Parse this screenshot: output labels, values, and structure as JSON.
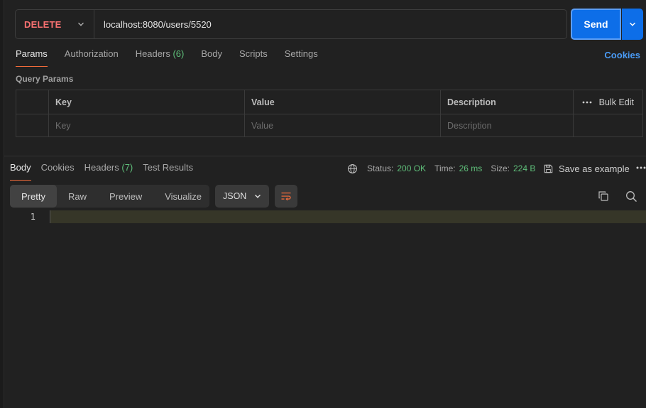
{
  "request": {
    "method": "DELETE",
    "url": "localhost:8080/users/5520",
    "send_label": "Send"
  },
  "request_tabs": [
    {
      "label": "Params",
      "active": true
    },
    {
      "label": "Authorization"
    },
    {
      "label": "Headers",
      "count": "(6)"
    },
    {
      "label": "Body"
    },
    {
      "label": "Scripts"
    },
    {
      "label": "Settings"
    }
  ],
  "cookies_label": "Cookies",
  "query_params": {
    "title": "Query Params",
    "columns": [
      "Key",
      "Value",
      "Description"
    ],
    "bulk_edit": "Bulk Edit",
    "placeholders": {
      "key": "Key",
      "value": "Value",
      "description": "Description"
    }
  },
  "response_tabs": [
    {
      "label": "Body",
      "active": true
    },
    {
      "label": "Cookies"
    },
    {
      "label": "Headers",
      "count": "(7)"
    },
    {
      "label": "Test Results"
    }
  ],
  "response_meta": {
    "status_label": "Status:",
    "status_value": "200 OK",
    "time_label": "Time:",
    "time_value": "26 ms",
    "size_label": "Size:",
    "size_value": "224 B",
    "save_example": "Save as example"
  },
  "view_modes": [
    {
      "label": "Pretty",
      "active": true
    },
    {
      "label": "Raw"
    },
    {
      "label": "Preview"
    },
    {
      "label": "Visualize"
    }
  ],
  "format": "JSON",
  "editor": {
    "line_numbers": [
      "1"
    ]
  },
  "colors": {
    "method": "#f87171",
    "accent": "#0d6ee8",
    "success": "#5fbf7a",
    "tab_underline": "#f26b3a",
    "link": "#4a9bf5"
  }
}
